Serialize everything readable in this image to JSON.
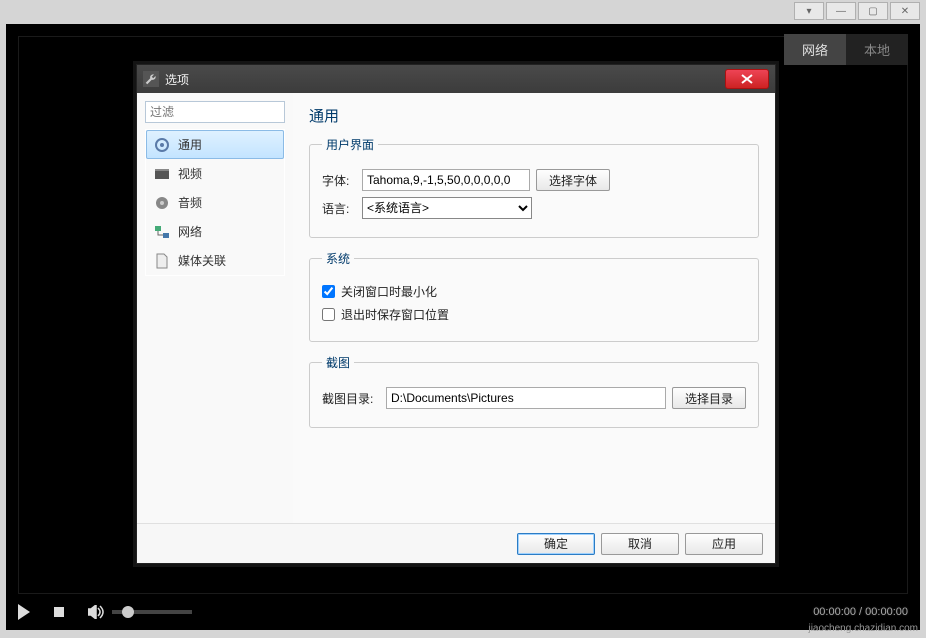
{
  "top_tabs": {
    "network": "网络",
    "local": "本地"
  },
  "player": {
    "time": "00:00:00 / 00:00:00"
  },
  "dialog": {
    "title": "选项",
    "filter_placeholder": "过滤",
    "sidebar": [
      {
        "label": "通用"
      },
      {
        "label": "视频"
      },
      {
        "label": "音频"
      },
      {
        "label": "网络"
      },
      {
        "label": "媒体关联"
      }
    ],
    "page_title": "通用",
    "group_ui": {
      "legend": "用户界面",
      "font_label": "字体:",
      "font_value": "Tahoma,9,-1,5,50,0,0,0,0,0",
      "font_btn": "选择字体",
      "lang_label": "语言:",
      "lang_value": "<系统语言>"
    },
    "group_system": {
      "legend": "系统",
      "opt1": "关闭窗口时最小化",
      "opt2": "退出时保存窗口位置"
    },
    "group_screenshot": {
      "legend": "截图",
      "dir_label": "截图目录:",
      "dir_value": "D:\\Documents\\Pictures",
      "dir_btn": "选择目录"
    },
    "footer": {
      "ok": "确定",
      "cancel": "取消",
      "apply": "应用"
    }
  },
  "watermark": "jiaocheng.chazidian.com"
}
